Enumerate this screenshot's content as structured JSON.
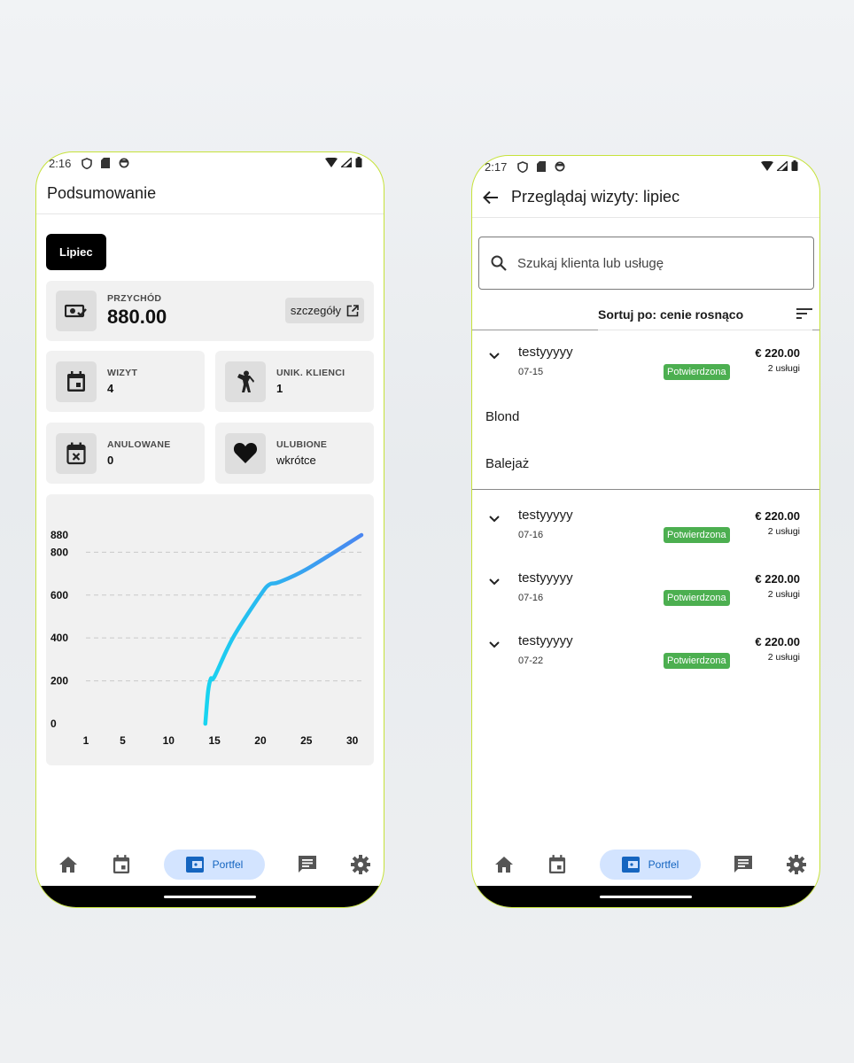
{
  "left": {
    "status": {
      "time": "2:16"
    },
    "title": "Podsumowanie",
    "month_chip": "Lipiec",
    "revenue": {
      "label": "PRZYCHÓD",
      "value": "880.00",
      "details_label": "szczegóły"
    },
    "stats": [
      {
        "label": "WIZYT",
        "value": "4",
        "icon": "calendar-icon"
      },
      {
        "label": "UNIK. KLIENCI",
        "value": "1",
        "icon": "person-icon"
      },
      {
        "label": "ANULOWANE",
        "value": "0",
        "icon": "calendar-cancel-icon"
      },
      {
        "label": "ULUBIONE",
        "value": "wkrótce",
        "icon": "heart-icon"
      }
    ],
    "chart_data": {
      "type": "line",
      "x_ticks": [
        "1",
        "5",
        "10",
        "15",
        "20",
        "25",
        "30"
      ],
      "y_ticks": [
        "0",
        "200",
        "400",
        "600",
        "800",
        "880"
      ],
      "xlim": [
        1,
        31
      ],
      "ylim": [
        0,
        880
      ],
      "grid": true,
      "points": [
        [
          14,
          0
        ],
        [
          14.3,
          150
        ],
        [
          14.6,
          210
        ],
        [
          15,
          220
        ],
        [
          17,
          400
        ],
        [
          20,
          600
        ],
        [
          21,
          650
        ],
        [
          22,
          660
        ],
        [
          25,
          720
        ],
        [
          31,
          880
        ]
      ],
      "colors": {
        "start": "#18d4f0",
        "end": "#4a86f0"
      }
    }
  },
  "right": {
    "status": {
      "time": "2:17"
    },
    "title": "Przeglądaj wizyty: lipiec",
    "search_placeholder": "Szukaj klienta lub usługę",
    "sort_label": "Sortuj po: cenie rosnąco",
    "visits": [
      {
        "name": "testyyyyy",
        "date": "07-15",
        "status": "Potwierdzona",
        "price": "€ 220.00",
        "count": "2 usługi"
      },
      {
        "name": "testyyyyy",
        "date": "07-16",
        "status": "Potwierdzona",
        "price": "€ 220.00",
        "count": "2 usługi"
      },
      {
        "name": "testyyyyy",
        "date": "07-16",
        "status": "Potwierdzona",
        "price": "€ 220.00",
        "count": "2 usługi"
      },
      {
        "name": "testyyyyy",
        "date": "07-22",
        "status": "Potwierdzona",
        "price": "€ 220.00",
        "count": "2 usługi"
      }
    ],
    "services": [
      "Blond",
      "Balejaż"
    ]
  },
  "nav": {
    "items": [
      "home-icon",
      "calendar-icon",
      "wallet-icon",
      "chat-icon",
      "settings-icon"
    ],
    "active_label": "Portfel"
  },
  "colors": {
    "accent": "#1565c0",
    "nav_active_bg": "#d3e4ff",
    "badge": "#4caf50",
    "phone_border": "#c6e23a"
  }
}
